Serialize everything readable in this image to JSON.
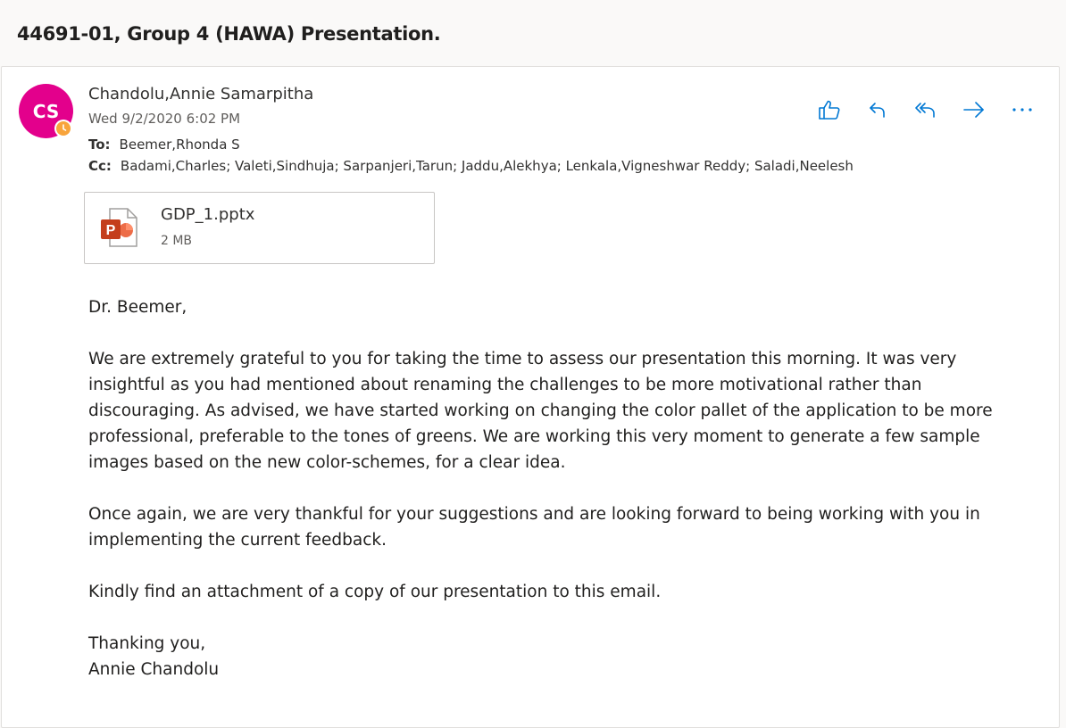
{
  "email": {
    "subject": "44691-01, Group 4 (HAWA) Presentation.",
    "avatar_initials": "CS",
    "avatar_color": "#e3008c",
    "sender": "Chandolu,Annie Samarpitha",
    "date": "Wed 9/2/2020 6:02 PM",
    "to_label": "To:",
    "to": "Beemer,Rhonda S",
    "cc_label": "Cc:",
    "cc": "Badami,Charles; Valeti,Sindhuja; Sarpanjeri,Tarun; Jaddu,Alekhya; Lenkala,Vigneshwar Reddy; Saladi,Neelesh",
    "actions": [
      "like-icon",
      "reply-icon",
      "reply-all-icon",
      "forward-icon",
      "more-icon"
    ],
    "accent_color": "#0078d4"
  },
  "attachment": {
    "name": "GDP_1.pptx",
    "size": "2 MB",
    "icon": "powerpoint-icon"
  },
  "body": {
    "greeting": "Dr. Beemer,",
    "paragraph1": "We are extremely grateful to you for taking the time to assess our presentation this morning. It was very insightful as you had mentioned about renaming the challenges to be more motivational rather than discouraging. As advised, we have started working on changing the color pallet of the application to be more professional, preferable to the tones of greens. We are working this very moment to generate a few sample images based on the new color-schemes, for a clear idea.",
    "paragraph2": "Once again, we are very thankful for your suggestions and are looking forward to being working with you in implementing the current feedback.",
    "paragraph3": "Kindly find an attachment of a copy of our presentation to this email.",
    "closing": "Thanking you,",
    "signature": "Annie Chandolu"
  }
}
